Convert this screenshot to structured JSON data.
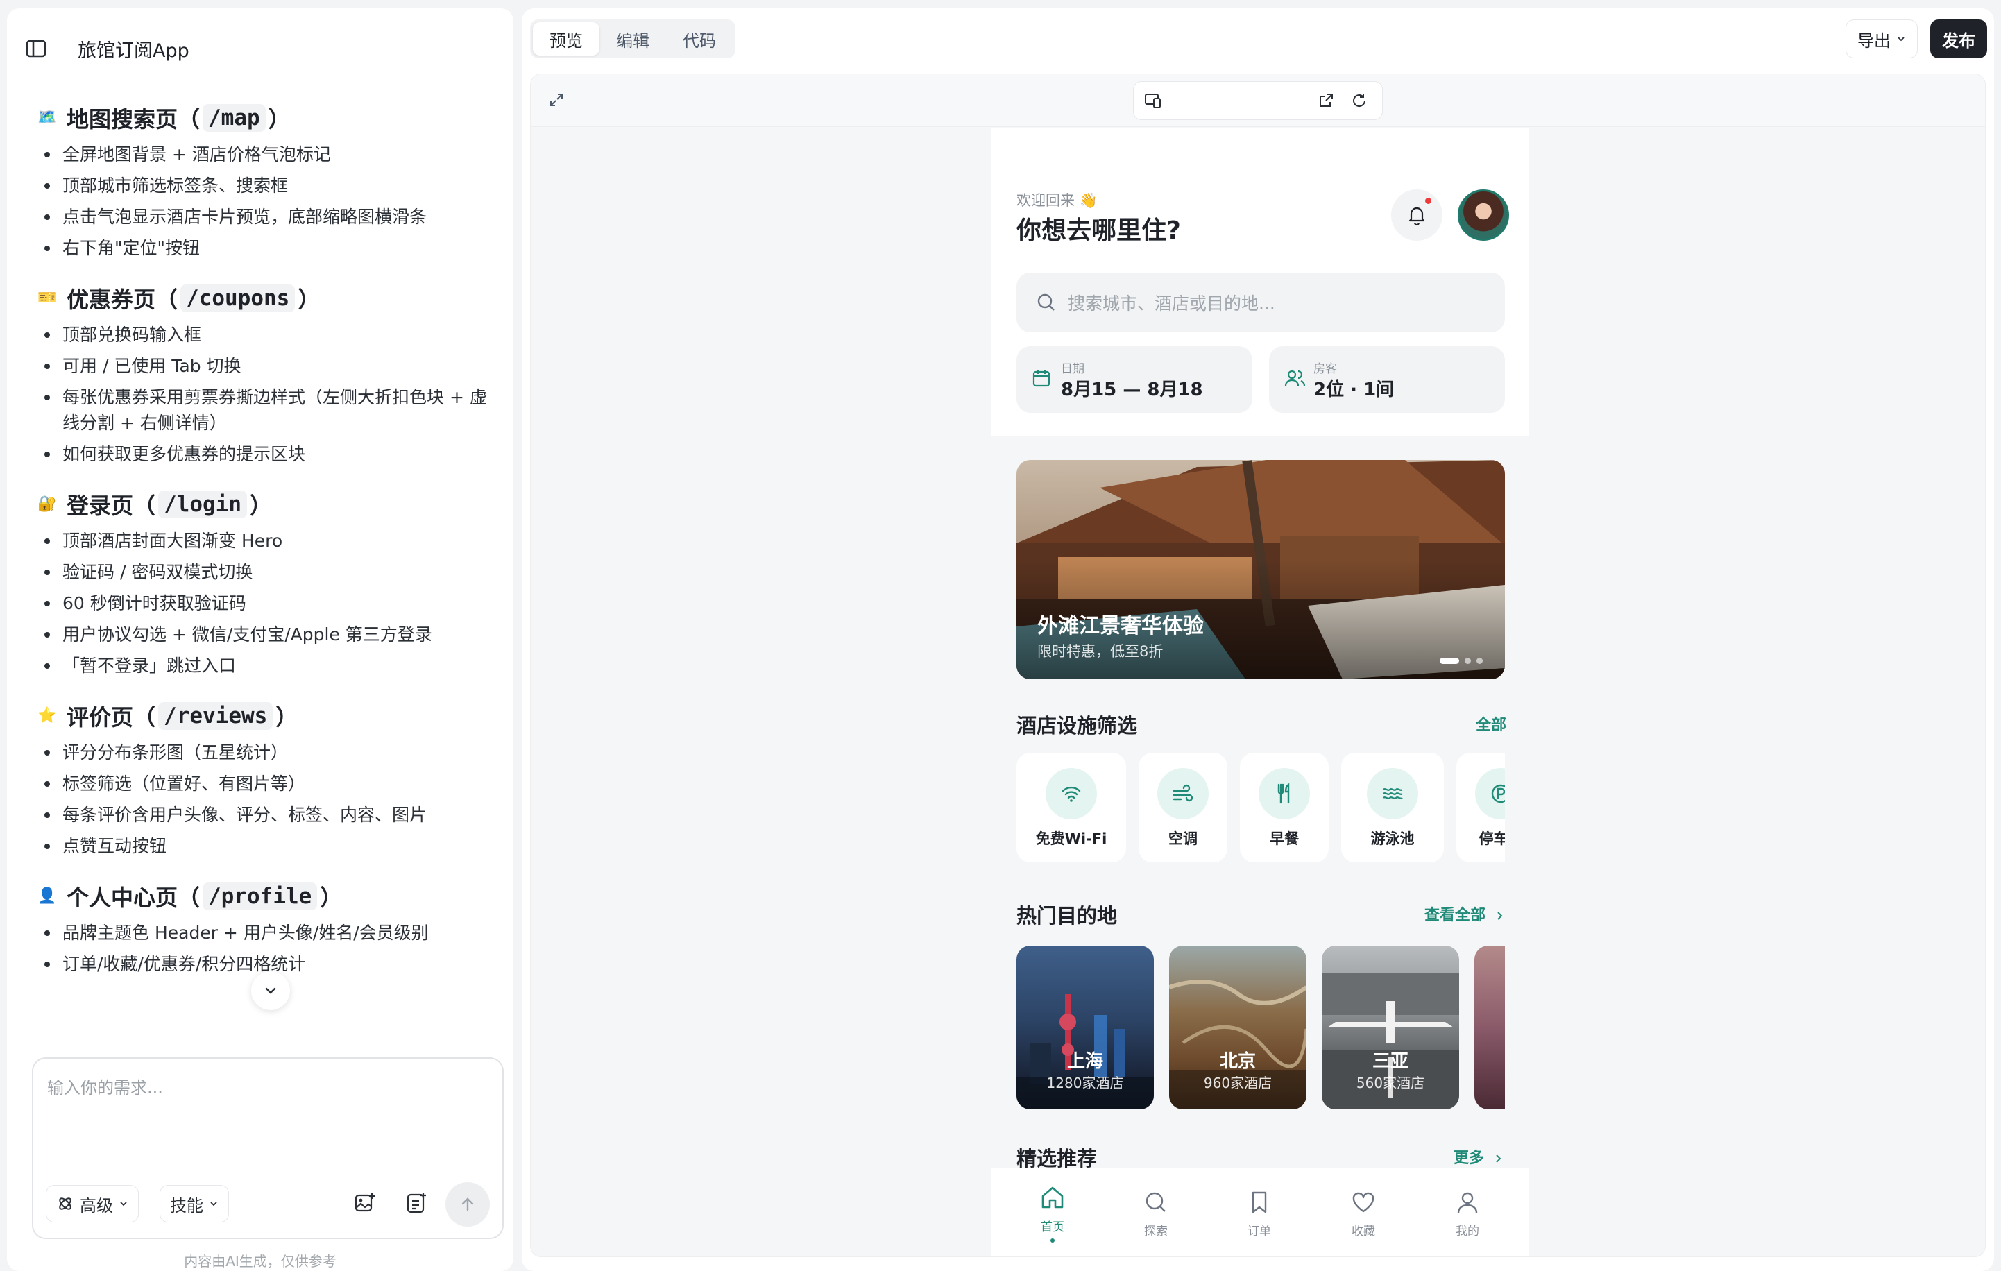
{
  "app": {
    "title": "旅馆订阅App"
  },
  "doc": {
    "sections": [
      {
        "emoji": "🗺️",
        "title_pre": "地图搜索页（",
        "route": "/map",
        "title_post": "）",
        "items": [
          "全屏地图背景 + 酒店价格气泡标记",
          "顶部城市筛选标签条、搜索框",
          "点击气泡显示酒店卡片预览，底部缩略图横滑条",
          "右下角\"定位\"按钮"
        ]
      },
      {
        "emoji": "🎫",
        "title_pre": "优惠券页（",
        "route": "/coupons",
        "title_post": "）",
        "items": [
          "顶部兑换码输入框",
          "可用 / 已使用 Tab 切换",
          "每张优惠券采用剪票券撕边样式（左侧大折扣色块 + 虚线分割 + 右侧详情）",
          "如何获取更多优惠券的提示区块"
        ]
      },
      {
        "emoji": "🔐",
        "title_pre": "登录页（",
        "route": "/login",
        "title_post": "）",
        "items": [
          "顶部酒店封面大图渐变 Hero",
          "验证码 / 密码双模式切换",
          "60 秒倒计时获取验证码",
          "用户协议勾选 + 微信/支付宝/Apple 第三方登录",
          "「暂不登录」跳过入口"
        ]
      },
      {
        "emoji": "⭐",
        "title_pre": "评价页（",
        "route": "/reviews",
        "title_post": "）",
        "items": [
          "评分分布条形图（五星统计）",
          "标签筛选（位置好、有图片等）",
          "每条评价含用户头像、评分、标签、内容、图片",
          "点赞互动按钮"
        ]
      },
      {
        "emoji": "👤",
        "title_pre": "个人中心页（",
        "route": "/profile",
        "title_post": "）",
        "items": [
          "品牌主题色 Header + 用户头像/姓名/会员级别",
          "订单/收藏/优惠券/积分四格统计"
        ]
      }
    ]
  },
  "composer": {
    "placeholder": "输入你的需求...",
    "advanced": "高级",
    "skills": "技能"
  },
  "footnote": "内容由AI生成，仅供参考",
  "toolbar": {
    "tabs": [
      "预览",
      "编辑",
      "代码"
    ],
    "export": "导出",
    "publish": "发布"
  },
  "phone": {
    "welcome": "欢迎回来 👋",
    "question": "你想去哪里住?",
    "search_placeholder": "搜索城市、酒店或目的地...",
    "date_label": "日期",
    "date_value": "8月15 — 8月18",
    "guest_label": "房客",
    "guest_value": "2位 · 1间",
    "banner_title": "外滩江景奢华体验",
    "banner_sub": "限时特惠，低至8折",
    "facilities_title": "酒店设施筛选",
    "facilities_link": "全部",
    "facilities": [
      "免费Wi-Fi",
      "空调",
      "早餐",
      "游泳池",
      "停车场"
    ],
    "popular_title": "热门目的地",
    "popular_link": "查看全部",
    "destinations": [
      {
        "city": "上海",
        "count": "1280家酒店"
      },
      {
        "city": "北京",
        "count": "960家酒店"
      },
      {
        "city": "三亚",
        "count": "560家酒店"
      }
    ],
    "featured_title": "精选推荐",
    "featured_link": "更多",
    "nav": [
      "首页",
      "探索",
      "订单",
      "收藏",
      "我的"
    ]
  },
  "colors": {
    "accent": "#1f8a77",
    "dark": "#1f2329"
  }
}
